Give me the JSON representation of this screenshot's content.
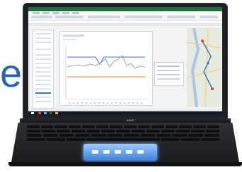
{
  "scene": {
    "description_free": true,
    "device": "laptop",
    "brand_mark": "ASUS",
    "background_glyph": "e",
    "accent_colors": {
      "excel_green": "#1d6f42",
      "series_blue": "#4472c4",
      "series_orange": "#ed7d31",
      "touchpad_glow": "#78b7ff",
      "glyph_blue": "#2b63b5"
    },
    "icons": {
      "screen_app": "spreadsheet-icon",
      "map_pane": "map-icon",
      "touchpad_controls": "touchpad-icon"
    }
  }
}
